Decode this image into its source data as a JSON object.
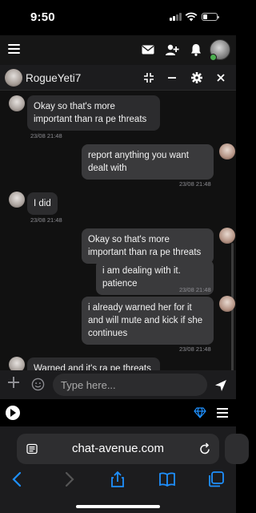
{
  "status": {
    "time": "9:50",
    "battery_level": 0.3
  },
  "app_bar": {
    "icons": [
      "menu-icon",
      "mail-icon",
      "add-user-icon",
      "bell-icon",
      "avatar"
    ],
    "online_color": "#4caf50"
  },
  "chat": {
    "name": "RogueYeti7",
    "header_icons": [
      "collapse-icon",
      "minimize-icon",
      "gear-icon",
      "close-icon"
    ],
    "messages": [
      {
        "side": "left",
        "text": "Okay so that's more important than ra pe threats",
        "time": "23/08 21:48"
      },
      {
        "side": "right",
        "text": "report anything you want dealt with",
        "time": "23/08 21:48"
      },
      {
        "side": "left",
        "text": "I did",
        "time": "23/08 21:48"
      },
      {
        "side": "right",
        "text": "Okay so that's more important than ra pe threats",
        "time": ""
      },
      {
        "side": "right",
        "text": "i am dealing with it. patience",
        "time": "23/08 21:48"
      },
      {
        "side": "right",
        "text": "i already warned her for it and will mute and kick if she continues",
        "time": "23/08 21:48"
      },
      {
        "side": "left",
        "text": "Warned and it's ra pe threats",
        "time": ""
      }
    ]
  },
  "composer": {
    "placeholder": "Type here..."
  },
  "browser": {
    "url": "chat-avenue.com"
  },
  "colors": {
    "accent": "#1e90ff",
    "bubble": "#2c2c2e"
  }
}
